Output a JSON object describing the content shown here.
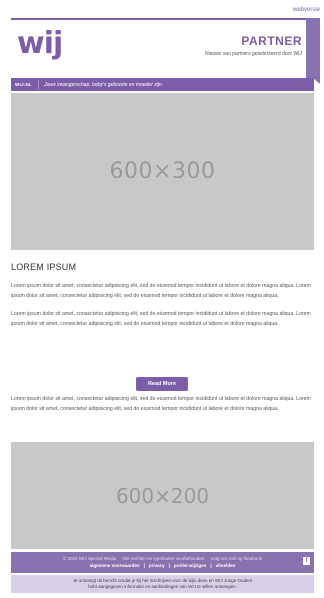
{
  "topbar": {
    "webversie": "webversie"
  },
  "header": {
    "logo": "wij",
    "partner_title": "PARTNER",
    "partner_subtitle": "Nieuws van partners geselecteerd door WIJ"
  },
  "nav": {
    "brand": "WIJ.NL",
    "tagline": "Jouw zwangerschap, baby's geboorte en moeder zijn"
  },
  "hero": {
    "placeholder": "600×300"
  },
  "article": {
    "headline": "LOREM IPSUM",
    "paragraphs": [
      "Lorem ipsum dolor sit amet, consectetur adipisicing elit, sed do eiusmod tempor incididunt ut labore et dolore magna aliqua. Lorem ipsum dolor sit amet, consectetur adipisicing elit, sed do eiusmod tempor incididunt ut labore et dolore magna aliqua.",
      "Lorem ipsum dolor sit amet, consectetur adipisicing elit, sed do eiusmod tempor incididunt ut labore et dolore magna aliqua. Lorem ipsum dolor sit amet, consectetur adipisicing elit, sed do eiusmod tempor incididunt ut labore et dolore magna aliqua.",
      "Lorem ipsum dolor sit amet, consectetur adipisicing elit, sed do eiusmod tempor incididunt ut labore et dolore magna aliqua. Lorem ipsum dolor sit amet, consectetur adipisicing elit, sed do eiusmod tempor incididunt ut labore et dolore magna aliqua."
    ],
    "read_more": "Read More"
  },
  "banner": {
    "placeholder": "600×200"
  },
  "footer": {
    "copyright": "© 2016 WIJ Special Media",
    "rights": "Alle rechten en typefouten voorbehouden",
    "follow": "Volg ons ook op facebook",
    "links": [
      "algemene voorwaarden",
      "privacy",
      "profiel wijzigen",
      "afmelden"
    ],
    "separator": "|",
    "facebook_icon_glyph": "f"
  },
  "disclaimer": {
    "line1": "Je ontvangt dit bericht omdat je bij het inschrijven voor de bijlo deos en WIJ Jonge Ouders",
    "line2": "hebt aangegeven informatie en aanbiedingen van WIJ te willen ontvangen."
  },
  "colors": {
    "accent": "#7b5ea7",
    "footer": "#8a72b0",
    "placeholder_bg": "#c8c8c8"
  }
}
